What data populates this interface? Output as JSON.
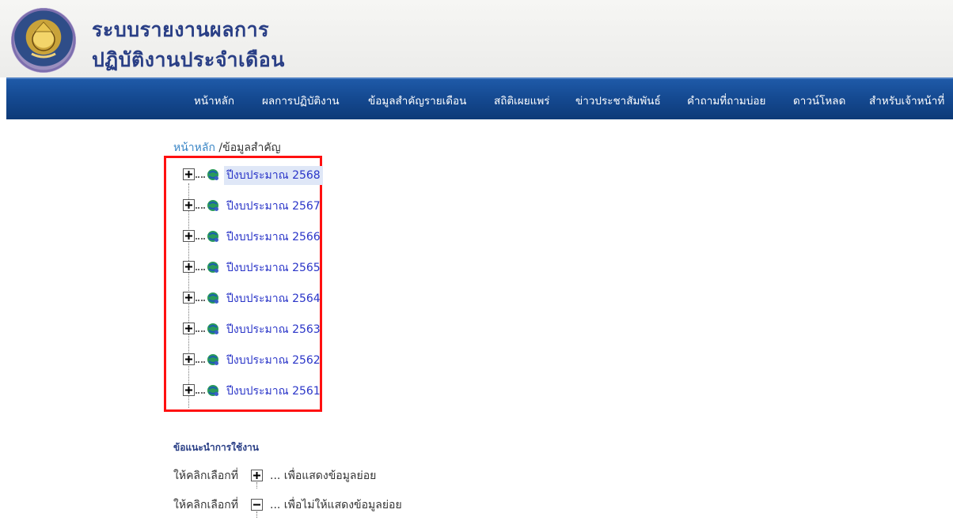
{
  "header": {
    "title_line1": "ระบบรายงานผลการ",
    "title_line2": "ปฏิบัติงานประจำเดือน"
  },
  "nav": {
    "items": [
      "หน้าหลัก",
      "ผลการปฏิบัติงาน",
      "ข้อมูลสำคัญรายเดือน",
      "สถิติเผยแพร่",
      "ข่าวประชาสัมพันธ์",
      "คำถามที่ถามบ่อย",
      "ดาวน์โหลด",
      "สำหรับเจ้าหน้าที่"
    ]
  },
  "breadcrumb": {
    "home": "หน้าหลัก",
    "current": "/ข้อมูลสำคัญ"
  },
  "tree": {
    "items": [
      {
        "label": "ปีงบประมาณ 2568",
        "selected": true
      },
      {
        "label": "ปีงบประมาณ 2567"
      },
      {
        "label": "ปีงบประมาณ 2566"
      },
      {
        "label": "ปีงบประมาณ 2565"
      },
      {
        "label": "ปีงบประมาณ 2564"
      },
      {
        "label": "ปีงบประมาณ 2563"
      },
      {
        "label": "ปีงบประมาณ 2562"
      },
      {
        "label": "ปีงบประมาณ 2561"
      }
    ]
  },
  "help": {
    "title": "ข้อแนะนำการใช้งาน",
    "expand_prefix": "ให้คลิกเลือกที่",
    "expand_suffix": "... เพื่อแสดงข้อมูลย่อย",
    "collapse_prefix": "ให้คลิกเลือกที่",
    "collapse_suffix": "... เพื่อไม่ให้แสดงข้อมูลย่อย"
  },
  "colors": {
    "nav_bg": "#154a92",
    "title": "#2a3f86",
    "tree_link": "#2a35c8",
    "highlight_border": "#ff1010"
  }
}
